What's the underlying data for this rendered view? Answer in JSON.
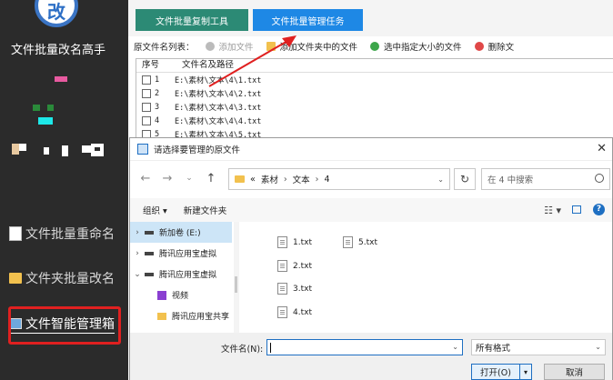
{
  "sidebar": {
    "logo_text": "改",
    "app_title": "文件批量改名高手",
    "items": [
      {
        "label": "文件批量重命名"
      },
      {
        "label": "文件夹批量改名"
      },
      {
        "label": "文件智能管理箱"
      }
    ]
  },
  "main": {
    "top_buttons": {
      "copy_tool": "文件批量复制工具",
      "manage_task": "文件批量管理任务"
    },
    "toolbar": {
      "list_label": "原文件名列表：",
      "add_file": "添加文件",
      "add_folder_files": "添加文件夹中的文件",
      "select_size": "选中指定大小的文件",
      "delete": "删除文"
    },
    "list": {
      "headers": [
        "序号",
        "文件名及路径"
      ],
      "rows": [
        {
          "num": "1",
          "path": "E:\\素材\\文本\\4\\1.txt"
        },
        {
          "num": "2",
          "path": "E:\\素材\\文本\\4\\2.txt"
        },
        {
          "num": "3",
          "path": "E:\\素材\\文本\\4\\3.txt"
        },
        {
          "num": "4",
          "path": "E:\\素材\\文本\\4\\4.txt"
        },
        {
          "num": "5",
          "path": "E:\\素材\\文本\\4\\5.txt"
        }
      ]
    }
  },
  "dialog": {
    "title": "请选择要管理的原文件",
    "address": {
      "prefix": "«",
      "parts": [
        "素材",
        "文本",
        "4"
      ]
    },
    "search_placeholder": "在 4 中搜索",
    "cmd": {
      "organize": "组织 ▾",
      "new_folder": "新建文件夹"
    },
    "nav": [
      {
        "chev": "›",
        "label": "新加卷 (E:)",
        "type": "drive"
      },
      {
        "chev": "›",
        "label": "腾讯应用宝虚拟",
        "type": "drive"
      },
      {
        "chev": "⌄",
        "label": "腾讯应用宝虚拟",
        "type": "drive"
      },
      {
        "chev": "",
        "label": "视频",
        "type": "video"
      },
      {
        "chev": "",
        "label": "腾讯应用宝共享",
        "type": "folder"
      }
    ],
    "files": [
      "1.txt",
      "5.txt",
      "2.txt",
      "3.txt",
      "4.txt"
    ],
    "filename_label": "文件名(N):",
    "filename_value": "",
    "filter": "所有格式",
    "open": "打开(O)",
    "cancel": "取消"
  },
  "colors": {
    "sidebar_bg": "#2b2b2b",
    "copy_btn": "#2c8a75",
    "manage_btn": "#1e88e5",
    "highlight": "#e02020"
  }
}
